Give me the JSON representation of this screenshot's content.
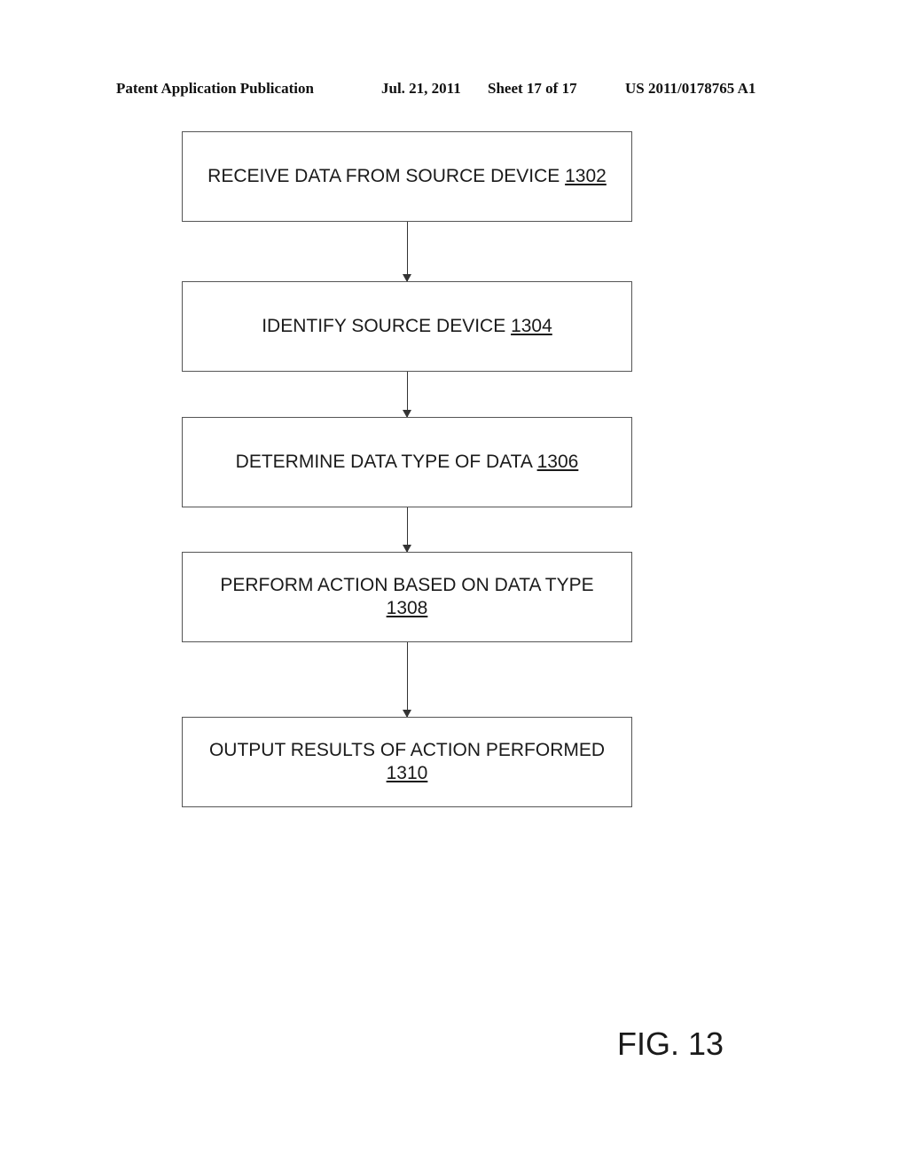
{
  "header": {
    "publication": "Patent Application Publication",
    "date": "Jul. 21, 2011",
    "sheet": "Sheet 17 of 17",
    "number": "US 2011/0178765 A1"
  },
  "flowchart": {
    "steps": [
      {
        "text": "RECEIVE DATA FROM SOURCE DEVICE",
        "ref": "1302"
      },
      {
        "text": "IDENTIFY SOURCE DEVICE",
        "ref": "1304"
      },
      {
        "text": "DETERMINE DATA TYPE OF DATA",
        "ref": "1306"
      },
      {
        "text": "PERFORM ACTION BASED ON DATA TYPE",
        "ref": "1308"
      },
      {
        "text": "OUTPUT RESULTS OF ACTION PERFORMED",
        "ref": "1310"
      }
    ]
  },
  "figure_label": "FIG. 13"
}
